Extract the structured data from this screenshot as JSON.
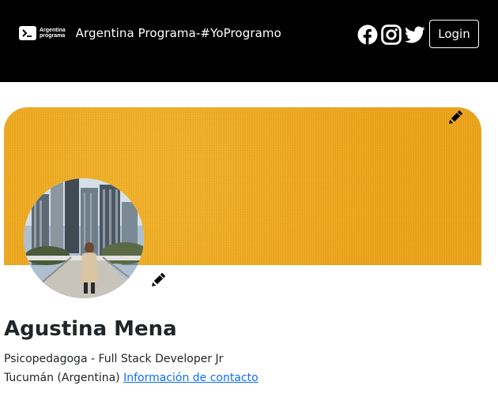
{
  "navbar": {
    "logo_text_line1": "Argentina",
    "logo_text_line2": "programa",
    "title": "Argentina Programa-#YoProgramo",
    "social": [
      {
        "icon": "facebook-icon"
      },
      {
        "icon": "instagram-icon"
      },
      {
        "icon": "twitter-icon"
      }
    ],
    "login_label": "Login"
  },
  "banner": {
    "background_color": "#f5ad1f",
    "edit_icon": "pencil-icon"
  },
  "profile": {
    "avatar_edit_icon": "pencil-icon",
    "name": "Agustina Mena",
    "headline": "Psicopedagoga - Full Stack Developer Jr",
    "location": "Tucumán (Argentina)",
    "contact_link": "Información de contacto",
    "link_color": "#0d6efd"
  }
}
